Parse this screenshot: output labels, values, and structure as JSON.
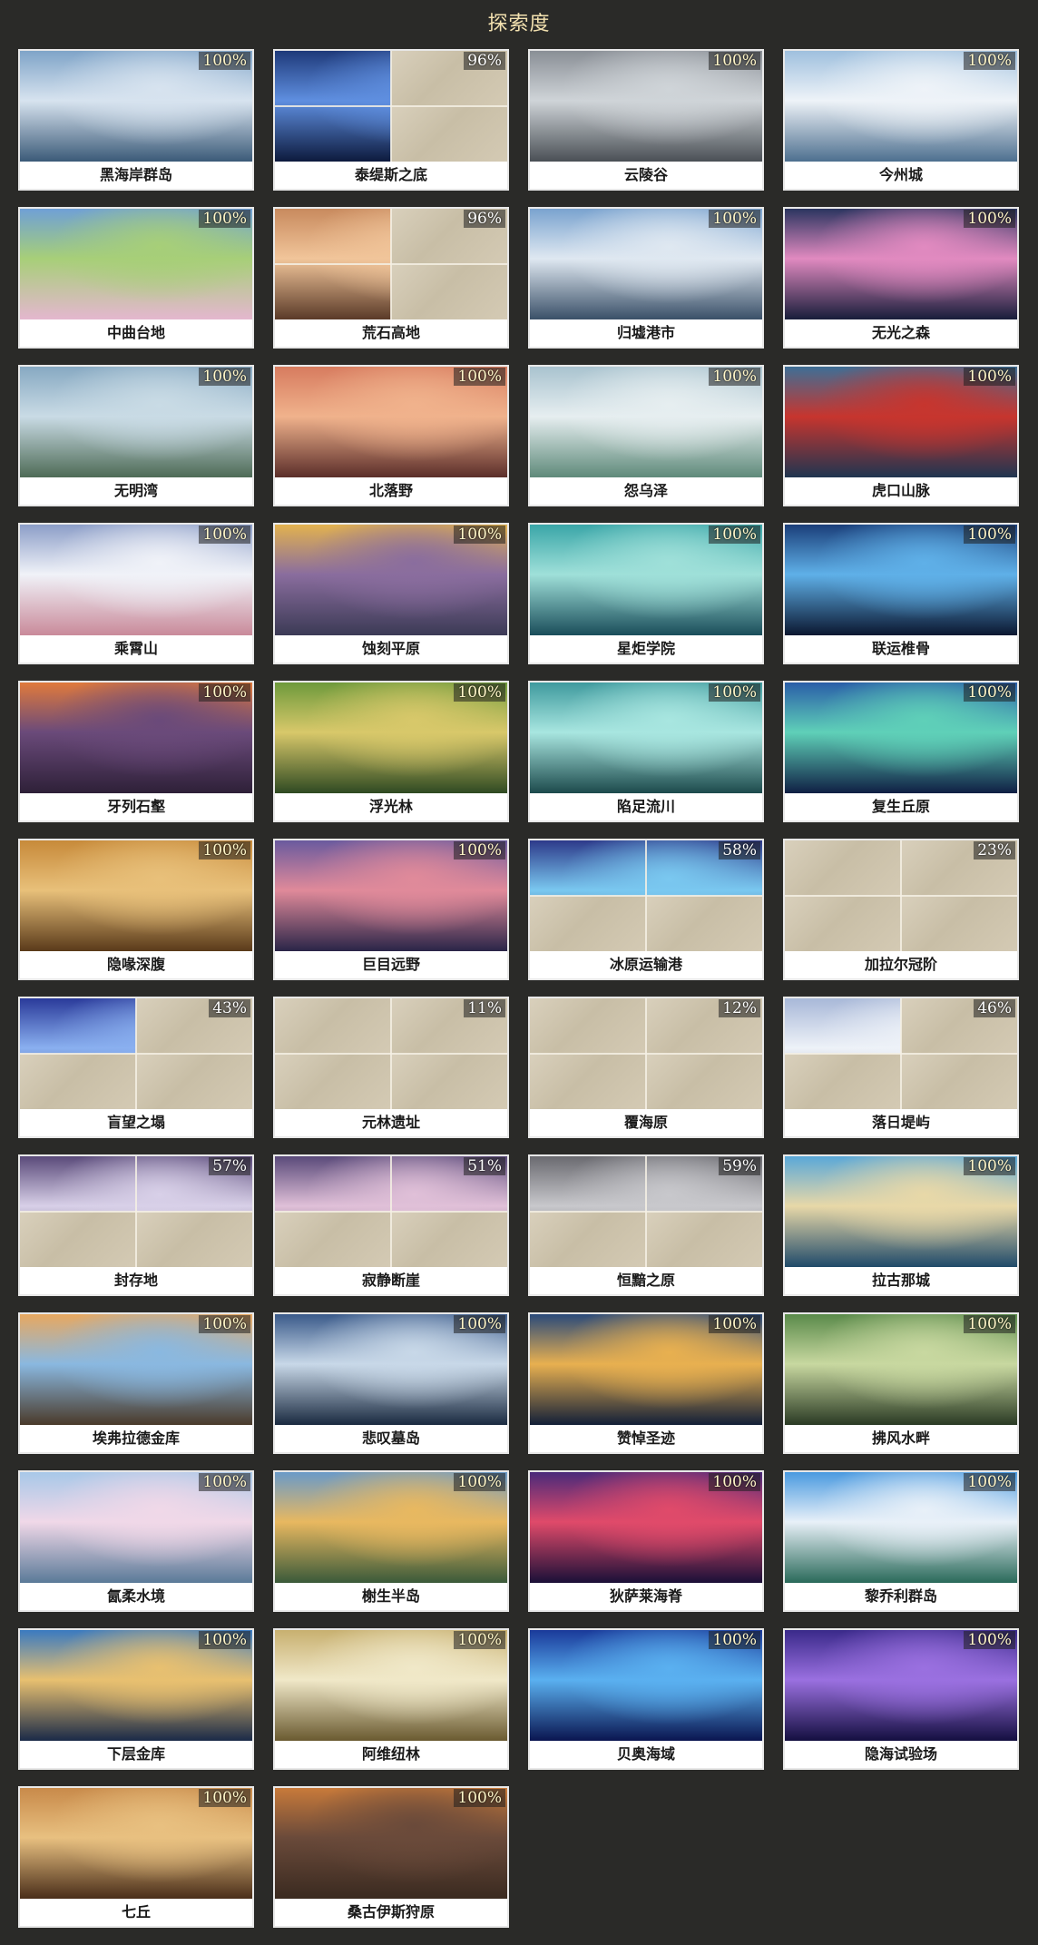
{
  "page": {
    "title": "探索度"
  },
  "regions": [
    {
      "name": "黑海岸群岛",
      "percent": "100%",
      "revealed": 1,
      "palette": [
        "#7fa4c8",
        "#d7e3ef",
        "#3b5a78"
      ]
    },
    {
      "name": "泰缇斯之底",
      "percent": "96%",
      "revealed": 0.96,
      "palette": [
        "#1f3a7a",
        "#5f8fe0",
        "#0d1a3d"
      ]
    },
    {
      "name": "云陵谷",
      "percent": "100%",
      "revealed": 1,
      "palette": [
        "#8a8f96",
        "#cfd4d8",
        "#4a4f55"
      ]
    },
    {
      "name": "今州城",
      "percent": "100%",
      "revealed": 1,
      "palette": [
        "#9fc0de",
        "#eef3f8",
        "#4d6f8f"
      ]
    },
    {
      "name": "中曲台地",
      "percent": "100%",
      "revealed": 1,
      "palette": [
        "#6fa0d6",
        "#a7cf78",
        "#e4b7cf"
      ]
    },
    {
      "name": "荒石高地",
      "percent": "96%",
      "revealed": 0.96,
      "palette": [
        "#c88a5e",
        "#f1c59a",
        "#5a3a28"
      ]
    },
    {
      "name": "归墟港市",
      "percent": "100%",
      "revealed": 1,
      "palette": [
        "#7aa3cf",
        "#dfe8f1",
        "#3a5068"
      ]
    },
    {
      "name": "无光之森",
      "percent": "100%",
      "revealed": 1,
      "palette": [
        "#2b3560",
        "#e18ac0",
        "#171d3a"
      ]
    },
    {
      "name": "无明湾",
      "percent": "100%",
      "revealed": 1,
      "palette": [
        "#87a9c2",
        "#c9dbe5",
        "#4e6b56"
      ]
    },
    {
      "name": "北落野",
      "percent": "100%",
      "revealed": 1,
      "palette": [
        "#d77b5f",
        "#f0b28c",
        "#5b2e2a"
      ]
    },
    {
      "name": "怨乌泽",
      "percent": "100%",
      "revealed": 1,
      "palette": [
        "#a9c3cf",
        "#e6eef0",
        "#5f8a7a"
      ]
    },
    {
      "name": "虎口山脉",
      "percent": "100%",
      "revealed": 1,
      "palette": [
        "#3e6f96",
        "#c7352e",
        "#1f3550"
      ]
    },
    {
      "name": "乘霄山",
      "percent": "100%",
      "revealed": 1,
      "palette": [
        "#8c9ec8",
        "#f0f2f8",
        "#c98a9a"
      ]
    },
    {
      "name": "蚀刻平原",
      "percent": "100%",
      "revealed": 1,
      "palette": [
        "#e2b24f",
        "#8a6d9e",
        "#3b3a55"
      ]
    },
    {
      "name": "星炬学院",
      "percent": "100%",
      "revealed": 1,
      "palette": [
        "#3aa6a8",
        "#9fe0d9",
        "#1a4d5a"
      ]
    },
    {
      "name": "联运椎骨",
      "percent": "100%",
      "revealed": 1,
      "palette": [
        "#1b3f7a",
        "#5fb0e8",
        "#0b1730"
      ]
    },
    {
      "name": "牙列石壑",
      "percent": "100%",
      "revealed": 1,
      "palette": [
        "#e07a3c",
        "#6a4a7a",
        "#2e2038"
      ]
    },
    {
      "name": "浮光林",
      "percent": "100%",
      "revealed": 1,
      "palette": [
        "#6e9a3c",
        "#d8c86a",
        "#2f4a22"
      ]
    },
    {
      "name": "陷足流川",
      "percent": "100%",
      "revealed": 1,
      "palette": [
        "#3f9a9e",
        "#a8e6e0",
        "#1c4a4c"
      ]
    },
    {
      "name": "复生丘原",
      "percent": "100%",
      "revealed": 1,
      "palette": [
        "#2a5ea8",
        "#5fd0b8",
        "#0f1f44"
      ]
    },
    {
      "name": "隐喙深腹",
      "percent": "100%",
      "revealed": 1,
      "palette": [
        "#c78a3a",
        "#e8c07a",
        "#5a3a1a"
      ]
    },
    {
      "name": "巨目远野",
      "percent": "100%",
      "revealed": 1,
      "palette": [
        "#6a5a9e",
        "#e08a9a",
        "#2a2548"
      ]
    },
    {
      "name": "冰原运输港",
      "percent": "58%",
      "revealed": 0.58,
      "palette": [
        "#2d3a8a",
        "#7ac8f0",
        "#141c4a"
      ]
    },
    {
      "name": "加拉尔冠阶",
      "percent": "23%",
      "revealed": 0.23,
      "palette": [
        "#cdc5b0",
        "#d9d0bc",
        "#b8ae96"
      ]
    },
    {
      "name": "盲望之塌",
      "percent": "43%",
      "revealed": 0.43,
      "palette": [
        "#2a3a9a",
        "#8ab0f0",
        "#141a50"
      ]
    },
    {
      "name": "元林遗址",
      "percent": "11%",
      "revealed": 0.11,
      "palette": [
        "#cdc5b0",
        "#d9d0bc",
        "#b8ae96"
      ]
    },
    {
      "name": "覆海原",
      "percent": "12%",
      "revealed": 0.12,
      "palette": [
        "#cdc5b0",
        "#d9d0bc",
        "#b8ae96"
      ]
    },
    {
      "name": "落日堤屿",
      "percent": "46%",
      "revealed": 0.46,
      "palette": [
        "#a8b8d8",
        "#eef2f8",
        "#6a7a9a"
      ]
    },
    {
      "name": "封存地",
      "percent": "57%",
      "revealed": 0.57,
      "palette": [
        "#5a4a7a",
        "#d8d0e8",
        "#2a2040"
      ]
    },
    {
      "name": "寂静断崖",
      "percent": "51%",
      "revealed": 0.51,
      "palette": [
        "#5a4a7a",
        "#e0c0d8",
        "#2a2040"
      ]
    },
    {
      "name": "恒黯之原",
      "percent": "59%",
      "revealed": 0.59,
      "palette": [
        "#6a6a70",
        "#c8c8cc",
        "#2a2a30"
      ]
    },
    {
      "name": "拉古那城",
      "percent": "100%",
      "revealed": 1,
      "palette": [
        "#5aa8d8",
        "#e8d8a8",
        "#1f4a6a"
      ]
    },
    {
      "name": "埃弗拉德金库",
      "percent": "100%",
      "revealed": 1,
      "palette": [
        "#e8a860",
        "#8ab8e0",
        "#4a3a2a"
      ]
    },
    {
      "name": "悲叹墓岛",
      "percent": "100%",
      "revealed": 1,
      "palette": [
        "#3a5a8a",
        "#c8d8e8",
        "#1a2a40"
      ]
    },
    {
      "name": "赞悼圣迹",
      "percent": "100%",
      "revealed": 1,
      "palette": [
        "#2a4a7a",
        "#e8b050",
        "#121f38"
      ]
    },
    {
      "name": "拂风水畔",
      "percent": "100%",
      "revealed": 1,
      "palette": [
        "#5a8a4a",
        "#c8d8a0",
        "#2a3a24"
      ]
    },
    {
      "name": "氤柔水境",
      "percent": "100%",
      "revealed": 1,
      "palette": [
        "#a8c8e8",
        "#f0d8e8",
        "#5a7a98"
      ]
    },
    {
      "name": "榭生半岛",
      "percent": "100%",
      "revealed": 1,
      "palette": [
        "#6a9ac8",
        "#e8b860",
        "#3a5a3a"
      ]
    },
    {
      "name": "狄萨莱海脊",
      "percent": "100%",
      "revealed": 1,
      "palette": [
        "#4a2a7a",
        "#e04a6a",
        "#1a1038"
      ]
    },
    {
      "name": "黎乔利群岛",
      "percent": "100%",
      "revealed": 1,
      "palette": [
        "#4a9ae0",
        "#e8f0f8",
        "#2a6a5a"
      ]
    },
    {
      "name": "下层金库",
      "percent": "100%",
      "revealed": 1,
      "palette": [
        "#3a7ac0",
        "#e8c070",
        "#1a2a48"
      ]
    },
    {
      "name": "阿维纽林",
      "percent": "100%",
      "revealed": 1,
      "palette": [
        "#c8b070",
        "#f0e8c8",
        "#6a5a30"
      ]
    },
    {
      "name": "贝奥海域",
      "percent": "100%",
      "revealed": 1,
      "palette": [
        "#1a3a9a",
        "#5ab0f0",
        "#0a1550"
      ]
    },
    {
      "name": "隐海试验场",
      "percent": "100%",
      "revealed": 1,
      "palette": [
        "#3a2a8a",
        "#9a70e0",
        "#140f40"
      ]
    },
    {
      "name": "七丘",
      "percent": "100%",
      "revealed": 1,
      "palette": [
        "#c88a4a",
        "#e8c080",
        "#4a2e1a"
      ]
    },
    {
      "name": "桑古伊斯狩原",
      "percent": "100%",
      "revealed": 1,
      "palette": [
        "#c87a3a",
        "#6a4a3a",
        "#3a2a20"
      ]
    }
  ]
}
